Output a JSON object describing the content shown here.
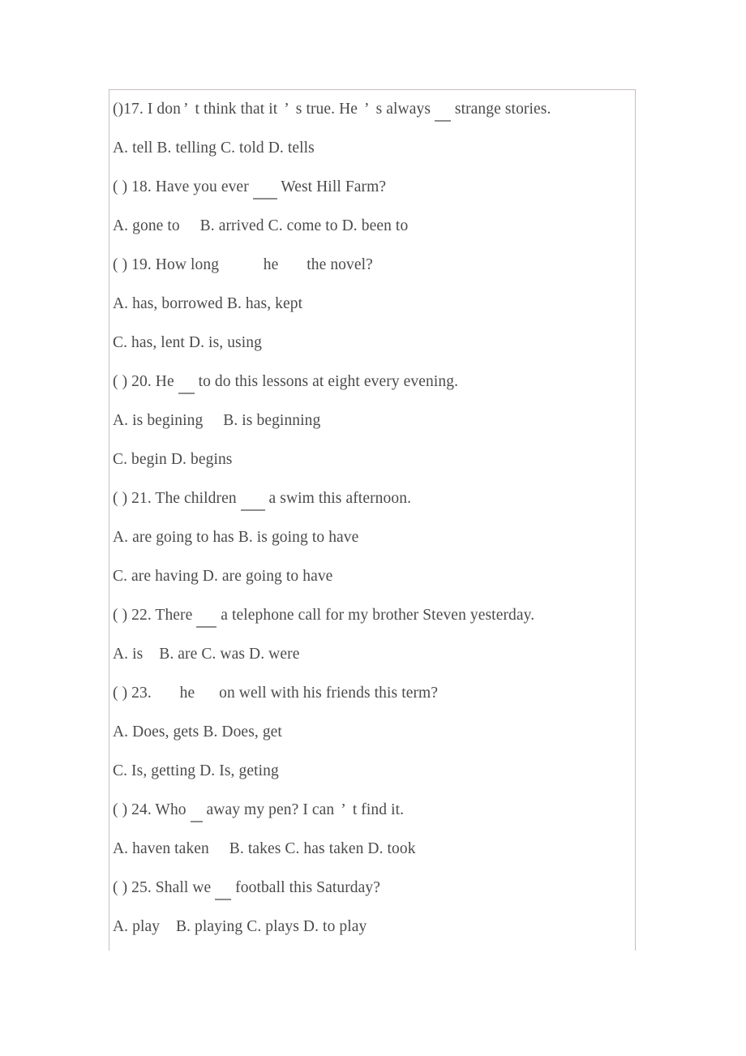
{
  "document": {
    "title": "Grammar Multiple Choice Exercise",
    "text_color": "#4b4b4b",
    "border_color": "#c9bcc6",
    "blank_rule_color": "#8d8d8d"
  },
  "lines": [
    {
      "id": "q17-stem",
      "type": "question",
      "number": "17",
      "segments": [
        {
          "text": "()17. I don"
        },
        {
          "apostrophe": "’"
        },
        {
          "text": " t think that it "
        },
        {
          "apostrophe": "’"
        },
        {
          "text": " s true. He "
        },
        {
          "apostrophe": "’"
        },
        {
          "text": " s always "
        },
        {
          "blank": "    "
        },
        {
          "text": " strange stories."
        }
      ]
    },
    {
      "id": "q17-options",
      "type": "options",
      "text": "A. tell B. telling C. told D. tells"
    },
    {
      "id": "q18-stem",
      "type": "question",
      "number": "18",
      "segments": [
        {
          "text": "( ) 18. Have you ever "
        },
        {
          "blank": "      "
        },
        {
          "text": " West Hill Farm?"
        }
      ]
    },
    {
      "id": "q18-options",
      "type": "options",
      "text": "A. gone to     B. arrived C. come to D. been to"
    },
    {
      "id": "q19-stem",
      "type": "question",
      "number": "19",
      "segments": [
        {
          "text": "( ) 19. How long "
        },
        {
          "gap": "          "
        },
        {
          "text": "he "
        },
        {
          "gap": "      "
        },
        {
          "text": "the novel?"
        }
      ]
    },
    {
      "id": "q19-options-a",
      "type": "options",
      "text": "A. has, borrowed B. has, kept"
    },
    {
      "id": "q19-options-b",
      "type": "options",
      "text": "C. has, lent D. is, using"
    },
    {
      "id": "q20-stem",
      "type": "question",
      "number": "20",
      "segments": [
        {
          "text": "( ) 20. He "
        },
        {
          "blank": "    "
        },
        {
          "text": " to do this lessons at eight every evening."
        }
      ]
    },
    {
      "id": "q20-options-a",
      "type": "options",
      "text": "A. is begining     B. is beginning"
    },
    {
      "id": "q20-options-b",
      "type": "options",
      "text": "C. begin D. begins"
    },
    {
      "id": "q21-stem",
      "type": "question",
      "number": "21",
      "segments": [
        {
          "text": "( ) 21. The children "
        },
        {
          "blank": "      "
        },
        {
          "text": " a swim this afternoon."
        }
      ]
    },
    {
      "id": "q21-options-a",
      "type": "options",
      "text": "A. are going to has B. is going to have"
    },
    {
      "id": "q21-options-b",
      "type": "options",
      "text": "C. are having D. are going to have"
    },
    {
      "id": "q22-stem",
      "type": "question",
      "number": "22",
      "segments": [
        {
          "text": "( ) 22. There "
        },
        {
          "blank": "     "
        },
        {
          "text": " a telephone call for my brother Steven yesterday."
        }
      ]
    },
    {
      "id": "q22-options",
      "type": "options",
      "text": "A. is    B. are C. was D. were"
    },
    {
      "id": "q23-stem",
      "type": "question",
      "number": "23",
      "segments": [
        {
          "text": "( ) 23. "
        },
        {
          "gap": "      "
        },
        {
          "text": "he "
        },
        {
          "gap": "     "
        },
        {
          "text": "on well with his friends this term?"
        }
      ]
    },
    {
      "id": "q23-options-a",
      "type": "options",
      "text": "A. Does, gets B. Does, get"
    },
    {
      "id": "q23-options-b",
      "type": "options",
      "text": "C. Is, getting D. Is, geting"
    },
    {
      "id": "q24-stem",
      "type": "question",
      "number": "24",
      "segments": [
        {
          "text": "( ) 24. Who "
        },
        {
          "blank": "   "
        },
        {
          "text": " away my pen? I can "
        },
        {
          "apostrophe": "’"
        },
        {
          "text": " t find it."
        }
      ]
    },
    {
      "id": "q24-options",
      "type": "options",
      "text": "A. haven taken     B. takes C. has taken D. took"
    },
    {
      "id": "q25-stem",
      "type": "question",
      "number": "25",
      "segments": [
        {
          "text": "( ) 25. Shall we "
        },
        {
          "blank": "    "
        },
        {
          "text": " football this Saturday?"
        }
      ]
    },
    {
      "id": "q25-options",
      "type": "options",
      "text": "A. play    B. playing C. plays D. to play"
    }
  ]
}
